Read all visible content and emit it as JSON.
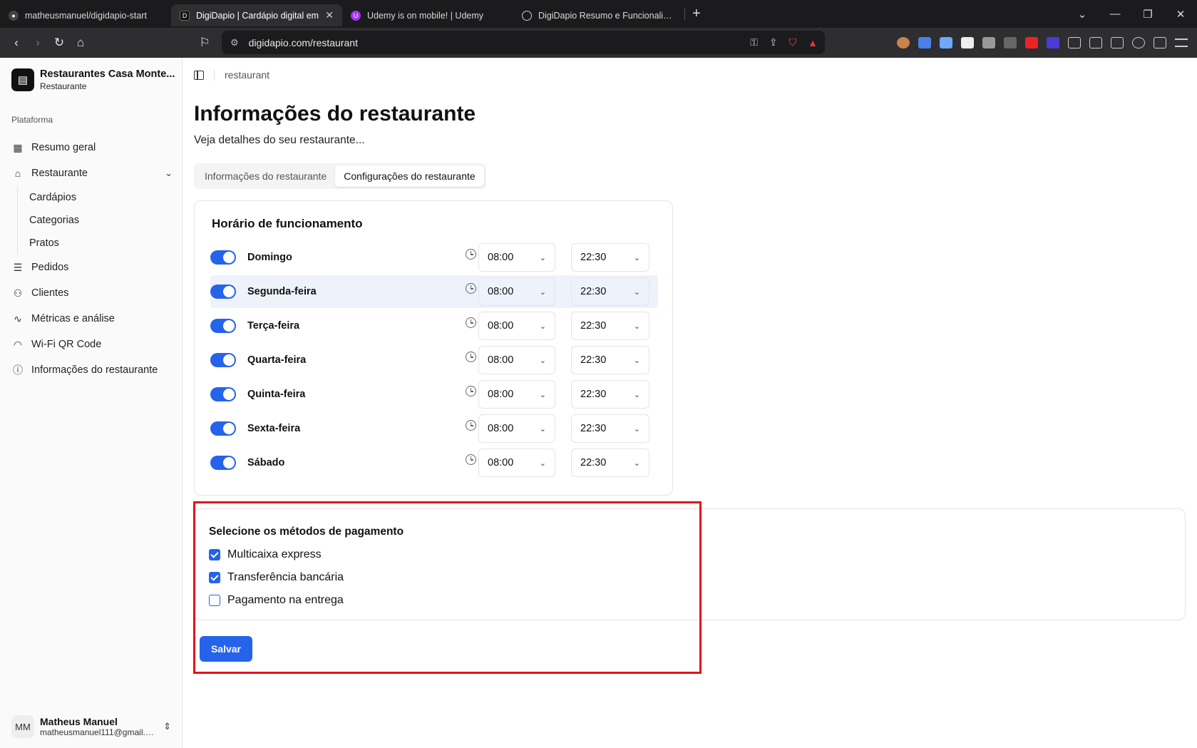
{
  "browser": {
    "tabs": [
      {
        "label": "matheusmanuel/digidapio-start",
        "active": false
      },
      {
        "label": "DigiDapio | Cardápio digital em",
        "active": true
      },
      {
        "label": "Udemy is on mobile! | Udemy",
        "active": false
      },
      {
        "label": "DigiDapio Resumo e Funcionalidade",
        "active": false
      }
    ],
    "url": "digidapio.com/restaurant"
  },
  "sidebar": {
    "brand_name": "Restaurantes Casa Monte...",
    "brand_sub": "Restaurante",
    "section_label": "Plataforma",
    "items": {
      "resumo": "Resumo geral",
      "restaurante": "Restaurante",
      "cardapios": "Cardápios",
      "categorias": "Categorias",
      "pratos": "Pratos",
      "pedidos": "Pedidos",
      "clientes": "Clientes",
      "metricas": "Métricas e análise",
      "wifi": "Wi-Fi QR Code",
      "info": "Informações do restaurante"
    },
    "user": {
      "initials": "MM",
      "name": "Matheus Manuel",
      "email": "matheusmanuel111@gmail.c..."
    }
  },
  "main": {
    "breadcrumb": "restaurant",
    "title": "Informações do restaurante",
    "subtitle": "Veja detalhes do seu restaurante...",
    "tabs": {
      "info": "Informações do restaurante",
      "config": "Configurações do restaurante"
    },
    "hours": {
      "title": "Horário de funcionamento",
      "separator": "-",
      "days": [
        {
          "name": "Domingo",
          "open": "08:00",
          "close": "22:30",
          "enabled": true
        },
        {
          "name": "Segunda-feira",
          "open": "08:00",
          "close": "22:30",
          "enabled": true
        },
        {
          "name": "Terça-feira",
          "open": "08:00",
          "close": "22:30",
          "enabled": true
        },
        {
          "name": "Quarta-feira",
          "open": "08:00",
          "close": "22:30",
          "enabled": true
        },
        {
          "name": "Quinta-feira",
          "open": "08:00",
          "close": "22:30",
          "enabled": true
        },
        {
          "name": "Sexta-feira",
          "open": "08:00",
          "close": "22:30",
          "enabled": true
        },
        {
          "name": "Sábado",
          "open": "08:00",
          "close": "22:30",
          "enabled": true
        }
      ]
    },
    "payment": {
      "title": "Selecione os métodos de pagamento",
      "options": [
        {
          "label": "Multicaixa express",
          "checked": true
        },
        {
          "label": "Transferência bancária",
          "checked": true
        },
        {
          "label": "Pagamento na entrega",
          "checked": false
        }
      ]
    },
    "save_label": "Salvar"
  },
  "colors": {
    "accent": "#2563eb",
    "highlight_box": "#e0141b"
  }
}
